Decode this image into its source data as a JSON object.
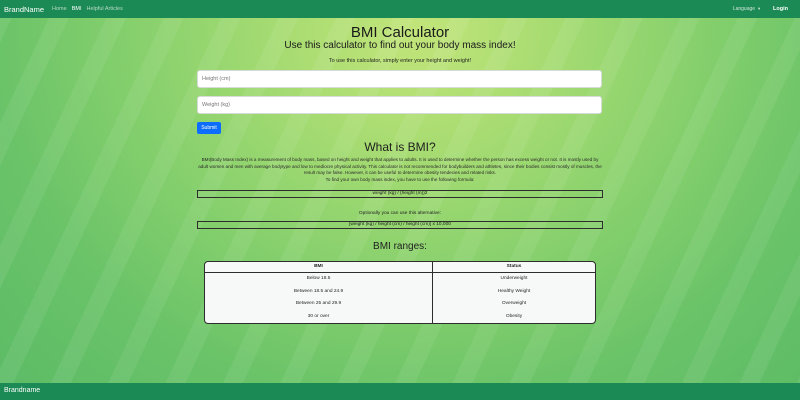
{
  "navbar": {
    "brand": "BrandName",
    "links": [
      "Home",
      "BMI",
      "Helpful Articles"
    ],
    "language": "Language",
    "login": "Login"
  },
  "hero": {
    "title": "BMI Calculator",
    "subtitle": "Use this calculator to find out your body mass index!",
    "instruction": "To use this calculator, simply enter your height and weight!"
  },
  "form": {
    "height_placeholder": "Height (cm)",
    "weight_placeholder": "Weight (kg)",
    "submit_label": "Submit"
  },
  "about": {
    "heading": "What is BMI?",
    "paragraph": "BMI(Body Mass Index) is a measurement of body mass, based on height and weight that applies to adults. It is used to determine whether the person has excess weight or not. It is mostly used by adult women and men with average bodytype and low to mediocre physical activity. This calculator is not recommended for bodybuilders and athletes, since their bodies consist mostly of muscles, the result may be false. However, it can be useful to determine obesity tendecies and related risks.",
    "formula_intro": "To find your own body mass index, you have to use the following formula:",
    "formula": "weight (kg) / (height (m))2",
    "alt_intro": "Optionally you can use this alternative:",
    "alt_formula": "[weight (kg) / height (cm) / height (cm)] x 10,000"
  },
  "ranges": {
    "heading": "BMI ranges:",
    "headers": [
      "BMI",
      "Status"
    ],
    "rows": [
      [
        "Below 18.5",
        "Underweight"
      ],
      [
        "Between 18.5 and 24.9",
        "Healthy Weight"
      ],
      [
        "Between 25 and 29.9",
        "Overweight"
      ],
      [
        "30 or over",
        "Obesity"
      ]
    ]
  },
  "footer": {
    "brand": "Brandname"
  },
  "colors": {
    "navbar": "#1c8a55",
    "submit": "#0d6efd"
  }
}
